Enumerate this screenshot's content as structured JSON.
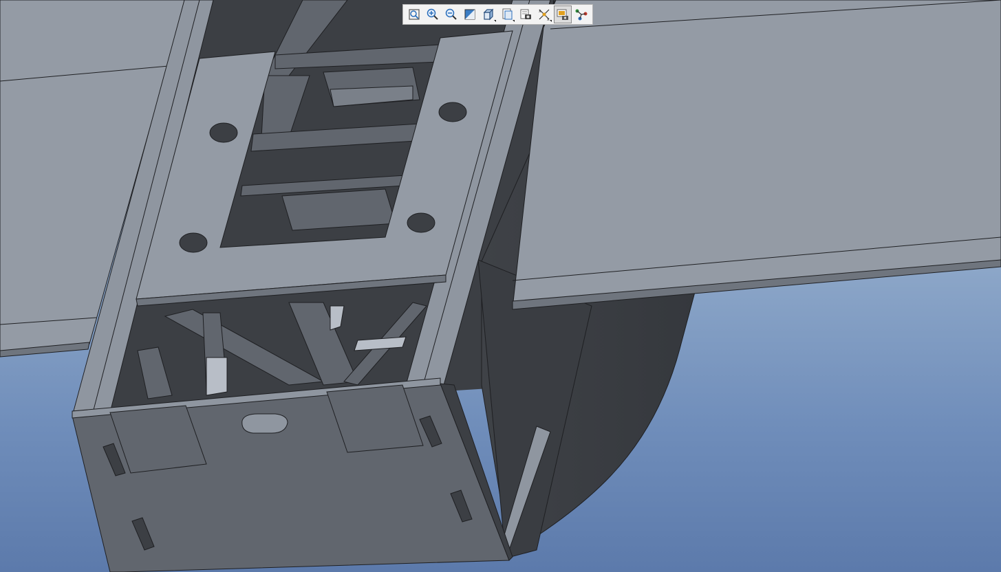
{
  "toolbar": {
    "buttons": [
      {
        "icon": "refit-icon"
      },
      {
        "icon": "zoom-in-icon"
      },
      {
        "icon": "zoom-out-icon"
      },
      {
        "icon": "repaint-icon"
      },
      {
        "icon": "view-orientation-icon"
      },
      {
        "icon": "saved-views-icon"
      },
      {
        "icon": "display-style-icon"
      },
      {
        "icon": "datum-display-icon"
      },
      {
        "icon": "spin-center-icon",
        "active": true
      },
      {
        "icon": "annotation-display-icon"
      }
    ]
  },
  "colors": {
    "background_top": "#a9bccf",
    "background_bottom": "#5c7aab",
    "model_light": "#949ba5",
    "model_mid": "#61666e",
    "model_dark": "#3c3f44",
    "edge": "#1e1f22",
    "toolbar_bg": "#f3f3f3"
  }
}
